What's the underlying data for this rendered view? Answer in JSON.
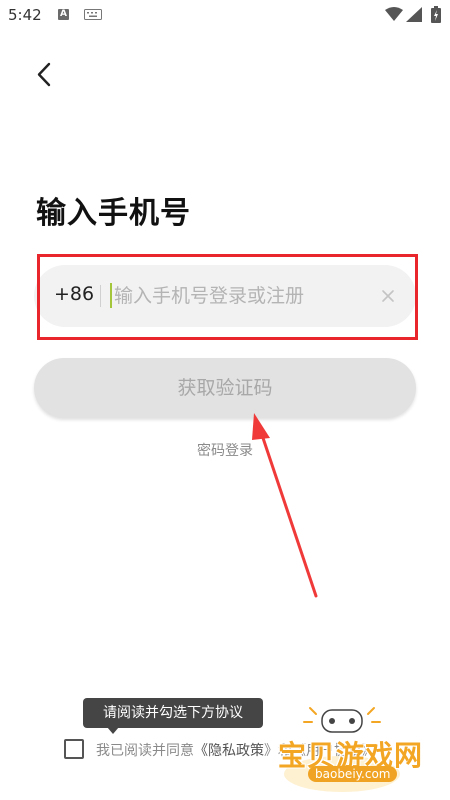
{
  "status_bar": {
    "time": "5:42",
    "icons": [
      "a-icon",
      "keyboard-icon",
      "wifi-icon",
      "signal-icon",
      "battery-icon"
    ]
  },
  "nav": {
    "back_icon": "chevron-left-icon"
  },
  "page": {
    "title": "输入手机号"
  },
  "phone_input": {
    "country_code": "+86",
    "placeholder": "输入手机号登录或注册",
    "value": "",
    "clear_icon": "close-icon"
  },
  "actions": {
    "get_code_label": "获取验证码",
    "password_login_label": "密码登录"
  },
  "agreement": {
    "tooltip": "请阅读并勾选下方协议",
    "prefix": "我已阅读并同意",
    "privacy_link": "《隐私政策",
    "rest": "》和《用户协议》",
    "checked": false
  },
  "watermark": {
    "text": "宝贝游戏网",
    "url": "baobeiy.com"
  },
  "colors": {
    "highlight": "#e8262c",
    "button_bg": "#e2e2e2",
    "input_bg": "#f2f2f2",
    "cursor": "#a4c63b",
    "watermark": "#f3a623"
  }
}
